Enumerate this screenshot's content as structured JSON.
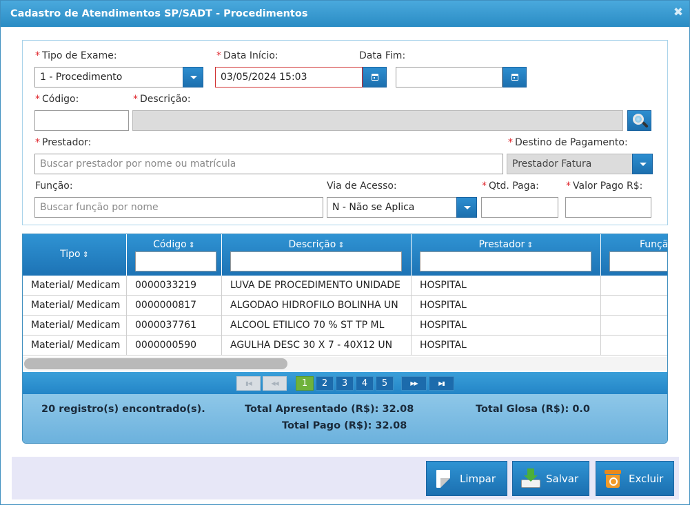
{
  "dialog": {
    "title": "Cadastro de Atendimentos SP/SADT - Procedimentos",
    "close_glyph": "✖"
  },
  "form": {
    "tipo_exame": {
      "label": "Tipo de Exame:",
      "value": "1 - Procedimento",
      "required": true
    },
    "data_inicio": {
      "label": "Data Início:",
      "value": "03/05/2024 15:03",
      "required": true
    },
    "data_fim": {
      "label": "Data Fim:",
      "value": "",
      "required": false
    },
    "codigo": {
      "label": "Código:",
      "value": "",
      "required": true
    },
    "descricao": {
      "label": "Descrição:",
      "value": "",
      "required": true
    },
    "prestador": {
      "label": "Prestador:",
      "placeholder": "Buscar prestador por nome ou matrícula",
      "required": true
    },
    "destino_pagamento": {
      "label": "Destino de Pagamento:",
      "value": "Prestador Fatura",
      "required": true
    },
    "funcao": {
      "label": "Função:",
      "placeholder": "Buscar função por nome",
      "required": false
    },
    "via_acesso": {
      "label": "Via de Acesso:",
      "value": "N - Não se Aplica",
      "required": false
    },
    "qtd_paga": {
      "label": "Qtd. Paga:",
      "value": "",
      "required": true
    },
    "valor_pago": {
      "label": "Valor Pago R$:",
      "value": "",
      "required": true
    }
  },
  "grid": {
    "columns": [
      {
        "label": "Tipo"
      },
      {
        "label": "Código"
      },
      {
        "label": "Descrição"
      },
      {
        "label": "Prestador"
      },
      {
        "label": "Funçã"
      }
    ],
    "rows": [
      {
        "tipo": "Material/ Medicam",
        "codigo": "0000033219",
        "descricao": "LUVA DE PROCEDIMENTO UNIDADE",
        "prestador": "HOSPITAL",
        "funcao": ""
      },
      {
        "tipo": "Material/ Medicam",
        "codigo": "0000000817",
        "descricao": "ALGODAO HIDROFILO BOLINHA UN",
        "prestador": "HOSPITAL",
        "funcao": ""
      },
      {
        "tipo": "Material/ Medicam",
        "codigo": "0000037761",
        "descricao": "ALCOOL ETILICO 70 % ST TP ML",
        "prestador": "HOSPITAL",
        "funcao": ""
      },
      {
        "tipo": "Material/ Medicam",
        "codigo": "0000000590",
        "descricao": "AGULHA DESC 30 X 7 - 40X12 UN",
        "prestador": "HOSPITAL",
        "funcao": ""
      }
    ],
    "horizontal_scroll_fraction": 0.41
  },
  "pager": {
    "first": "▮◀",
    "prev": "◀◀",
    "pages": [
      "1",
      "2",
      "3",
      "4",
      "5"
    ],
    "current_page": "1",
    "next": "▶▶",
    "last": "▶▮"
  },
  "summary": {
    "records": "20 registro(s) encontrado(s).",
    "total_apresentado": "Total Apresentado (R$): 32.08",
    "total_glosa": "Total Glosa (R$): 0.0",
    "total_pago": "Total Pago (R$): 32.08"
  },
  "actions": {
    "limpar": "Limpar",
    "salvar": "Salvar",
    "excluir": "Excluir"
  },
  "colors": {
    "accent": "#2a8cc4",
    "required": "#e0262c",
    "active_page": "#6fb23b"
  }
}
